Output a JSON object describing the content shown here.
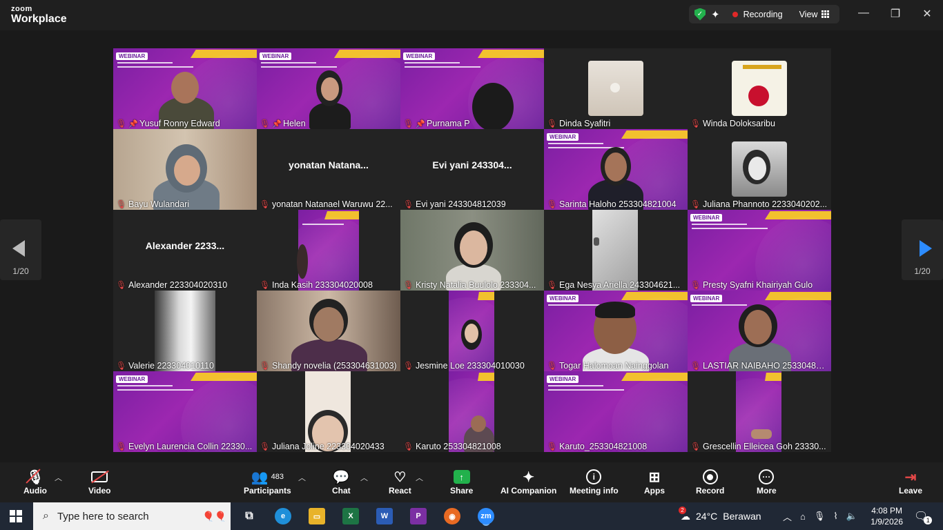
{
  "app": {
    "brand_top": "zoom",
    "brand_bottom": "Workplace"
  },
  "titlebar": {
    "recording_label": "Recording",
    "view_label": "View",
    "colors": {
      "recording_dot": "#e02828",
      "shield": "#23b14d"
    }
  },
  "pager": {
    "left_label": "1/20",
    "right_label": "1/20",
    "right_arrow_color": "#2d8cff"
  },
  "tiles": [
    {
      "name": "Yusuf Ronny Edward",
      "pinned": true
    },
    {
      "name": "Helen",
      "pinned": true,
      "active": true
    },
    {
      "name": "Purnama P",
      "pinned": true
    },
    {
      "name": "Dinda Syafitri"
    },
    {
      "name": "Winda Doloksaribu"
    },
    {
      "name": "Bayu Wulandari"
    },
    {
      "name": "yonatan Natanael Waruwu 22...",
      "center": "yonatan  Natana..."
    },
    {
      "name": "Evi yani 243304812039",
      "center": "Evi yani 243304..."
    },
    {
      "name": "Sarinta Haloho 253304821004"
    },
    {
      "name": "Juliana Phannoto 2233040202..."
    },
    {
      "name": "Alexander 223304020310",
      "center": "Alexander  2233..."
    },
    {
      "name": "Inda Kasih 233304020008"
    },
    {
      "name": "Kristy Natalia Buulolo 233304..."
    },
    {
      "name": "Ega Nesya Ariella 243304621..."
    },
    {
      "name": "Presty Syafni Khairiyah Gulo"
    },
    {
      "name": "Valerie 223304010110"
    },
    {
      "name": "Shandy novelia (253304631003)"
    },
    {
      "name": "Jesmine Loe 233304010030"
    },
    {
      "name": "Togar Halomoan Nainggolan"
    },
    {
      "name": "LASTIAR NAIBAHO 253304821..."
    },
    {
      "name": "Evelyn Laurencia Collin  22330..."
    },
    {
      "name": "Juliana Joline 223304020433"
    },
    {
      "name": "Karuto 253304821008"
    },
    {
      "name": "Karuto_253304821008"
    },
    {
      "name": "Grescellin Elleicea Goh 23330..."
    }
  ],
  "webinar_tag": "WEBINAR",
  "toolbar": {
    "audio": "Audio",
    "video": "Video",
    "participants": "Participants",
    "participants_count": "483",
    "chat": "Chat",
    "react": "React",
    "share": "Share",
    "ai_companion": "AI Companion",
    "meeting_info": "Meeting info",
    "apps": "Apps",
    "record": "Record",
    "more": "More",
    "leave": "Leave"
  },
  "taskbar": {
    "search_placeholder": "Type here to search",
    "weather_temp": "24°C",
    "weather_desc": "Berawan",
    "time": "4:08 PM",
    "date": "1/9/2026",
    "notification_count": "1",
    "weather_badge": "2"
  }
}
